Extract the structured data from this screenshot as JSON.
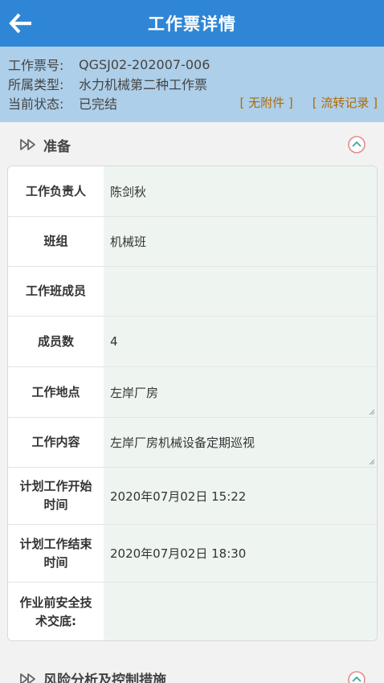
{
  "header": {
    "title": "工作票详情",
    "back_icon": "back-arrow-icon"
  },
  "ticket": {
    "fields": [
      {
        "label": "工作票号:",
        "value": "QGSJ02-202007-006"
      },
      {
        "label": "所属类型:",
        "value": "水力机械第二种工作票"
      },
      {
        "label": "当前状态:",
        "value": "已完结"
      }
    ],
    "attachment_link": "[ 无附件 ]",
    "flow_link": "[ 流转记录 ]"
  },
  "section": {
    "title": "准备",
    "rows": [
      {
        "label": "工作负责人",
        "value": "陈剑秋"
      },
      {
        "label": "班组",
        "value": "机械班"
      },
      {
        "label": "工作班成员",
        "value": ""
      },
      {
        "label": "成员数",
        "value": "4"
      },
      {
        "label": "工作地点",
        "value": "左岸厂房"
      },
      {
        "label": "工作内容",
        "value": "左岸厂房机械设备定期巡视"
      },
      {
        "label": "计划工作开始时间",
        "value": "2020年07月02日  15:22"
      },
      {
        "label": "计划工作结束时间",
        "value": "2020年07月02日  18:30"
      },
      {
        "label": "作业前安全技术交底:",
        "value": ""
      }
    ]
  },
  "next_section": {
    "title": "风险分析及控制措施"
  },
  "colors": {
    "header": "#2f86d6",
    "info_bg": "#aecfe9",
    "link": "#b06a00",
    "value_bg": "#eef5f1"
  }
}
